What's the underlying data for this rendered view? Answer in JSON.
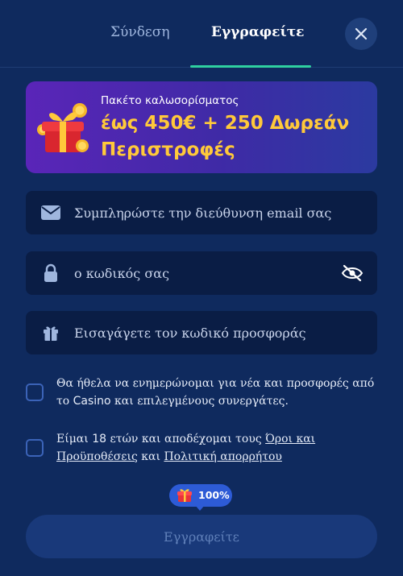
{
  "tabs": {
    "login_label": "Σύνδεση",
    "register_label": "Εγγραφείτε",
    "active": "register"
  },
  "banner": {
    "kicker": "Πακέτο καλωσορίσματος",
    "headline": "έως 450€ + 250 Δωρεάν Περιστροφές",
    "icon": "gift-box-coins-icon"
  },
  "form": {
    "email_placeholder": "Συμπληρώστε την διεύθυνση email σας",
    "password_placeholder": "ο κωδικός σας",
    "promo_placeholder": "Εισαγάγετε τον κωδικό προσφοράς"
  },
  "consent": {
    "newsletter_pre": "Θα ήθελα να ενημερώνομαι για νέα και προσφορές από το ",
    "newsletter_brand": "Casino",
    "newsletter_post": " και επιλεγμένους συνεργάτες.",
    "age_pre": "Είμαι ",
    "age_num": "18",
    "age_mid": " ετών και αποδέχομαι τους ",
    "terms_link": "Όροι και Προϋποθέσεις",
    "and": " και ",
    "privacy_link": "Πολιτική απορρήτου"
  },
  "progress": {
    "label": "100%",
    "value": 1.0
  },
  "submit_label": "Εγγραφείτε",
  "colors": {
    "background": "#0f2a5e",
    "accent": "#2fd0a0",
    "banner_headline": "#ffc93a",
    "field_bg": "#0a1d45"
  }
}
